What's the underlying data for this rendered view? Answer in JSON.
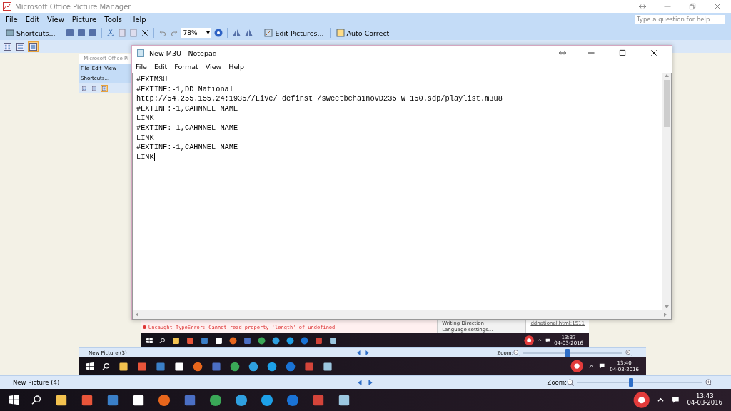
{
  "window": {
    "title": "Microsoft Office Picture Manager"
  },
  "menu": [
    "File",
    "Edit",
    "View",
    "Picture",
    "Tools",
    "Help"
  ],
  "help_box": {
    "placeholder": "Type a question for help"
  },
  "toolbar": {
    "shortcuts": "Shortcuts...",
    "zoom": "78%",
    "edit_pictures": "Edit Pictures...",
    "auto_correct": "Auto Correct"
  },
  "view_buttons": [
    {
      "selected": false
    },
    {
      "selected": false
    },
    {
      "selected": true
    }
  ],
  "screenshot": {
    "app_title": "Microsoft Office Pi",
    "menu": [
      "File",
      "Edit",
      "View"
    ],
    "shortcuts": "Shortcuts...",
    "view_buttons": [
      {
        "selected": false
      },
      {
        "selected": false
      },
      {
        "selected": true
      }
    ],
    "console_error": "Uncaught TypeError: Cannot read property 'length' of undefined",
    "context_menu": [
      "Writing Direction",
      "Language settings..."
    ],
    "console_link": "ddnational.html:1511",
    "inner_taskbar": {
      "time": "13:37",
      "date": "04-03-2016"
    },
    "status_bar": {
      "picture_name": "New Picture (3)",
      "zoom_label": "Zoom:",
      "zoom": {
        "level": 0.45
      }
    },
    "taskbar": {
      "time": "13:40",
      "date": "04-03-2016"
    }
  },
  "notepad": {
    "title": "New M3U - Notepad",
    "menu": [
      "File",
      "Edit",
      "Format",
      "View",
      "Help"
    ],
    "lines": [
      "#EXTM3U",
      "#EXTINF:-1,DD National",
      "http://54.255.155.24:1935//Live/_definst_/sweetbcha1novD235_W_150.sdp/playlist.m3u8",
      "#EXTINF:-1,CAHNNEL NAME",
      "LINK",
      "#EXTINF:-1,CAHNNEL NAME",
      "LINK",
      "#EXTINF:-1,CAHNNEL NAME",
      "LINK"
    ]
  },
  "status_bar": {
    "picture_name": "New Picture (4)",
    "zoom_label": "Zoom:",
    "zoom": {
      "level": 0.43
    }
  },
  "taskbar": {
    "time": "13:43",
    "date": "04-03-2016"
  }
}
